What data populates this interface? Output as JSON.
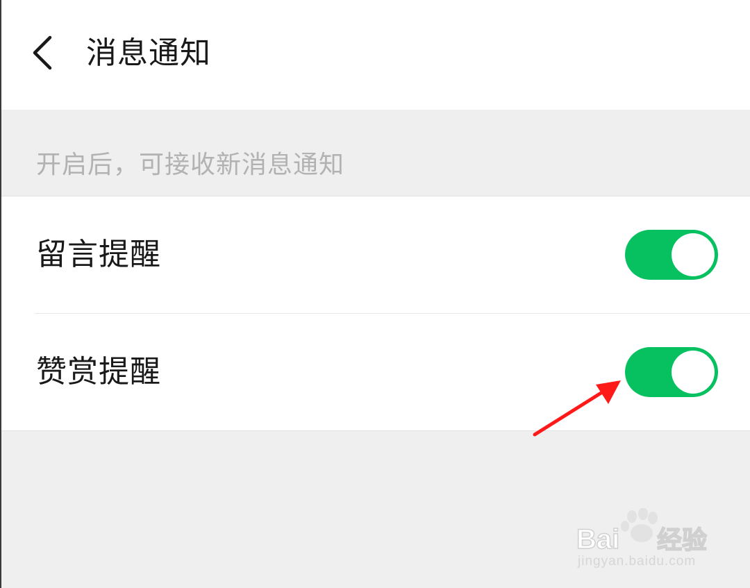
{
  "header": {
    "title": "消息通知",
    "back_icon": "chevron-left-icon"
  },
  "section": {
    "hint": "开启后，可接收新消息通知"
  },
  "settings": {
    "items": [
      {
        "label": "留言提醒",
        "enabled": true
      },
      {
        "label": "赞赏提醒",
        "enabled": true
      }
    ]
  },
  "colors": {
    "toggle_on": "#07c160",
    "annotation_arrow": "#ff1a1a",
    "background": "#efefef"
  },
  "watermark": {
    "brand": "Baidu经验",
    "url": "jingyan.baidu.com"
  }
}
